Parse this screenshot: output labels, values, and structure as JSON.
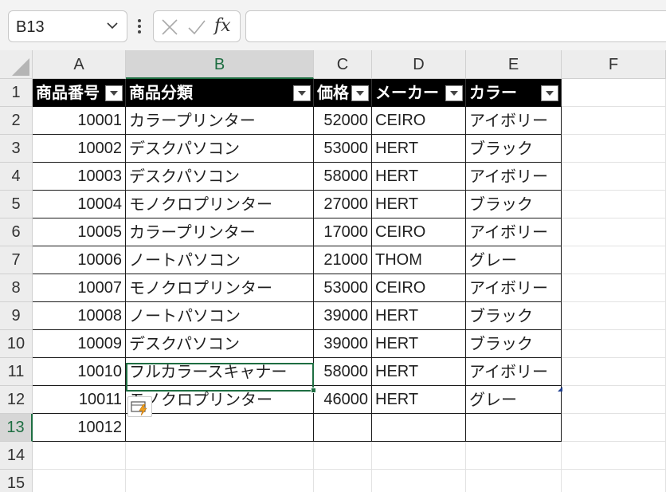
{
  "name_box": {
    "value": "B13"
  },
  "formula_bar": {
    "fx_label": "fx",
    "content": ""
  },
  "columns": [
    "A",
    "B",
    "C",
    "D",
    "E",
    "F"
  ],
  "selected_column": "B",
  "rows": [
    "1",
    "2",
    "3",
    "4",
    "5",
    "6",
    "7",
    "8",
    "9",
    "10",
    "11",
    "12",
    "13",
    "14",
    "15"
  ],
  "selected_row": "13",
  "table": {
    "headers": [
      "商品番号",
      "商品分類",
      "価格",
      "メーカー",
      "カラー"
    ],
    "records": [
      [
        "10001",
        "カラープリンター",
        "52000",
        "CEIRO",
        "アイボリー"
      ],
      [
        "10002",
        "デスクパソコン",
        "53000",
        "HERT",
        "ブラック"
      ],
      [
        "10003",
        "デスクパソコン",
        "58000",
        "HERT",
        "アイボリー"
      ],
      [
        "10004",
        "モノクロプリンター",
        "27000",
        "HERT",
        "ブラック"
      ],
      [
        "10005",
        "カラープリンター",
        "17000",
        "CEIRO",
        "アイボリー"
      ],
      [
        "10006",
        "ノートパソコン",
        "21000",
        "THOM",
        "グレー"
      ],
      [
        "10007",
        "モノクロプリンター",
        "53000",
        "CEIRO",
        "アイボリー"
      ],
      [
        "10008",
        "ノートパソコン",
        "39000",
        "HERT",
        "ブラック"
      ],
      [
        "10009",
        "デスクパソコン",
        "39000",
        "HERT",
        "ブラック"
      ],
      [
        "10010",
        "フルカラースキャナー",
        "58000",
        "HERT",
        "アイボリー"
      ],
      [
        "10011",
        "モノクロプリンター",
        "46000",
        "HERT",
        "グレー"
      ],
      [
        "10012",
        "",
        "",
        "",
        ""
      ]
    ]
  },
  "icons": {
    "name_box_dropdown": "chevron-down-icon",
    "more_options": "vertical-dots-icon",
    "cancel": "x-icon",
    "enter": "check-icon",
    "flash_fill": "flash-fill-icon",
    "filter": "filter-dropdown-icon"
  },
  "colors": {
    "accent": "#1e6e42",
    "table_header_bg": "#000000",
    "header_bg": "#ededed"
  }
}
